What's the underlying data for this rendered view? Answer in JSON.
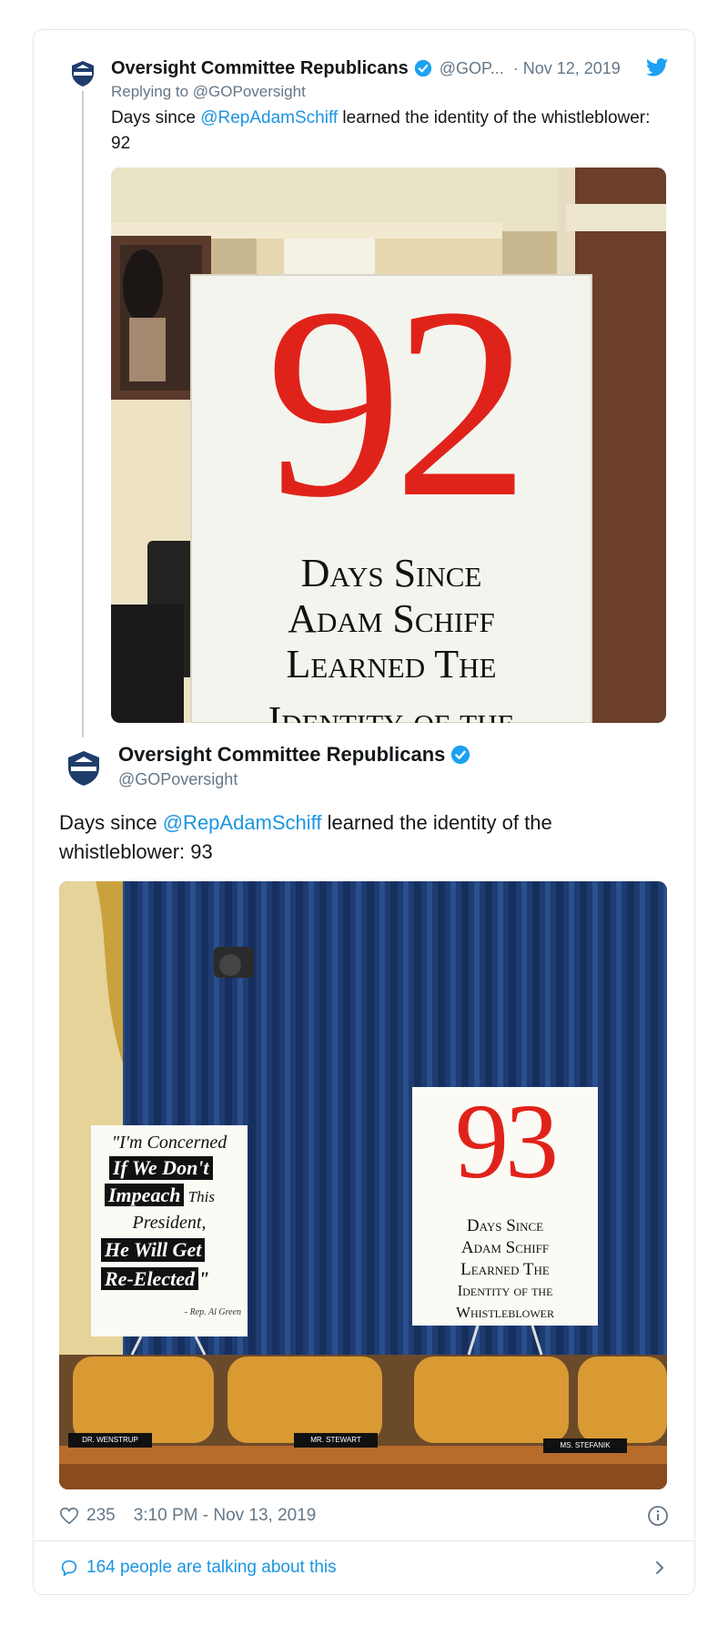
{
  "reply_tweet": {
    "author_name": "Oversight Committee Republicans",
    "handle": "@GOP...",
    "date": "· Nov 12, 2019",
    "replying_to_prefix": "Replying to ",
    "replying_to_handle": "@GOPoversight",
    "text_prefix": "Days since ",
    "mention": "@RepAdamSchiff",
    "text_suffix": " learned the identity of the whistleblower: 92",
    "sign": {
      "number": "92",
      "line1": "Days Since",
      "line2": "Adam Schiff",
      "line3": "Learned The",
      "line4": "Identity of the"
    }
  },
  "main_tweet": {
    "author_name": "Oversight Committee Republicans",
    "handle": "@GOPoversight",
    "text_prefix": "Days since ",
    "mention": "@RepAdamSchiff",
    "text_suffix": " learned the identity of the whistleblower: 93",
    "sign_left": {
      "l1": "\"I'm Concerned",
      "l2": "If We Don't",
      "l3a": "Impeach",
      "l3b": " This",
      "l4": "President,",
      "l5": "He Will Get",
      "l6": "Re-Elected",
      "l6b": "\"",
      "attribution": "- Rep. Al Green"
    },
    "sign_right": {
      "number": "93",
      "l1": "Days Since",
      "l2": "Adam Schiff",
      "l3": "Learned The",
      "l4": "Identity of the",
      "l5": "Whistleblower"
    },
    "nameplates": [
      "DR. WENSTRUP",
      "MR. STEWART",
      "MS. STEFANIK"
    ],
    "likes": "235",
    "timestamp": "3:10 PM - Nov 13, 2019",
    "talking": "164 people are talking about this"
  },
  "colors": {
    "twitter_blue": "#1b95e0",
    "verified_blue": "#1da1f2",
    "gray": "#657786",
    "sign_red": "#e0231a"
  },
  "icons": [
    "verified-icon",
    "twitter-bird-icon",
    "heart-icon",
    "info-icon",
    "comment-icon",
    "chevron-right-icon"
  ]
}
